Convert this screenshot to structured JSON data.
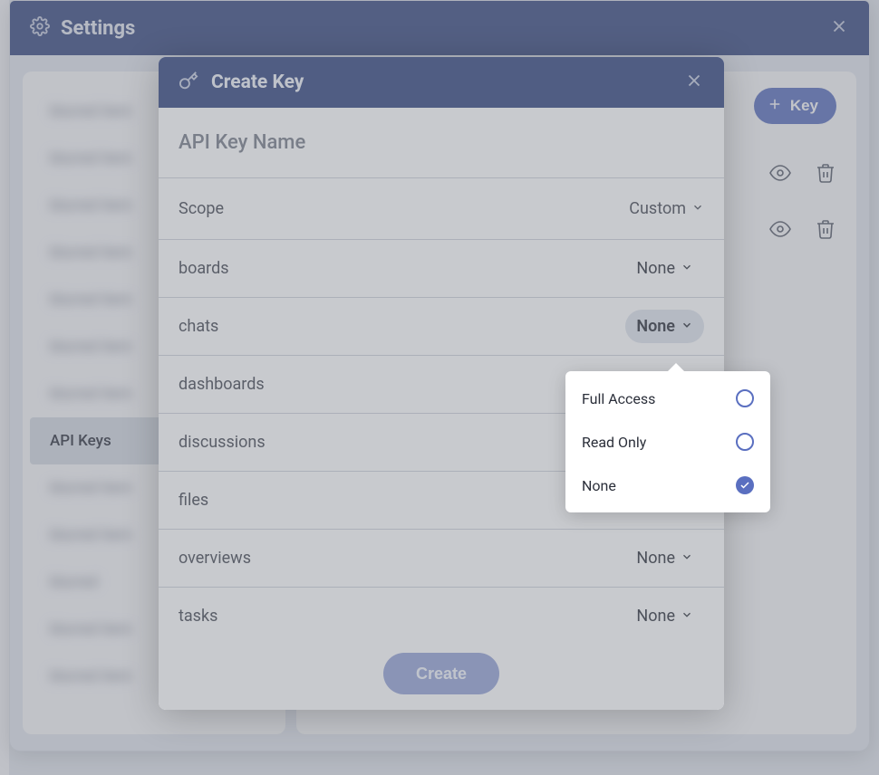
{
  "settings": {
    "title": "Settings",
    "sidebar": {
      "items": [
        {
          "label": "blurred item"
        },
        {
          "label": "blurred item"
        },
        {
          "label": "blurred item"
        },
        {
          "label": "blurred item"
        },
        {
          "label": "blurred item"
        },
        {
          "label": "blurred item"
        },
        {
          "label": "blurred item"
        },
        {
          "label": "API Keys"
        },
        {
          "label": "blurred item"
        },
        {
          "label": "blurred item"
        },
        {
          "label": "blurred"
        },
        {
          "label": "blurred item"
        },
        {
          "label": "blurred item"
        }
      ],
      "active_index": 7
    },
    "main": {
      "add_key_button": "Key"
    }
  },
  "modal": {
    "title": "Create Key",
    "name_placeholder": "API Key Name",
    "scope_label": "Scope",
    "scope_value": "Custom",
    "permissions": [
      {
        "name": "boards",
        "value": "None"
      },
      {
        "name": "chats",
        "value": "None",
        "open": true
      },
      {
        "name": "dashboards",
        "value": ""
      },
      {
        "name": "discussions",
        "value": ""
      },
      {
        "name": "files",
        "value": ""
      },
      {
        "name": "overviews",
        "value": "None"
      },
      {
        "name": "tasks",
        "value": "None"
      }
    ],
    "create_button": "Create"
  },
  "popover": {
    "options": [
      "Full Access",
      "Read Only",
      "None"
    ],
    "selected": "None"
  }
}
